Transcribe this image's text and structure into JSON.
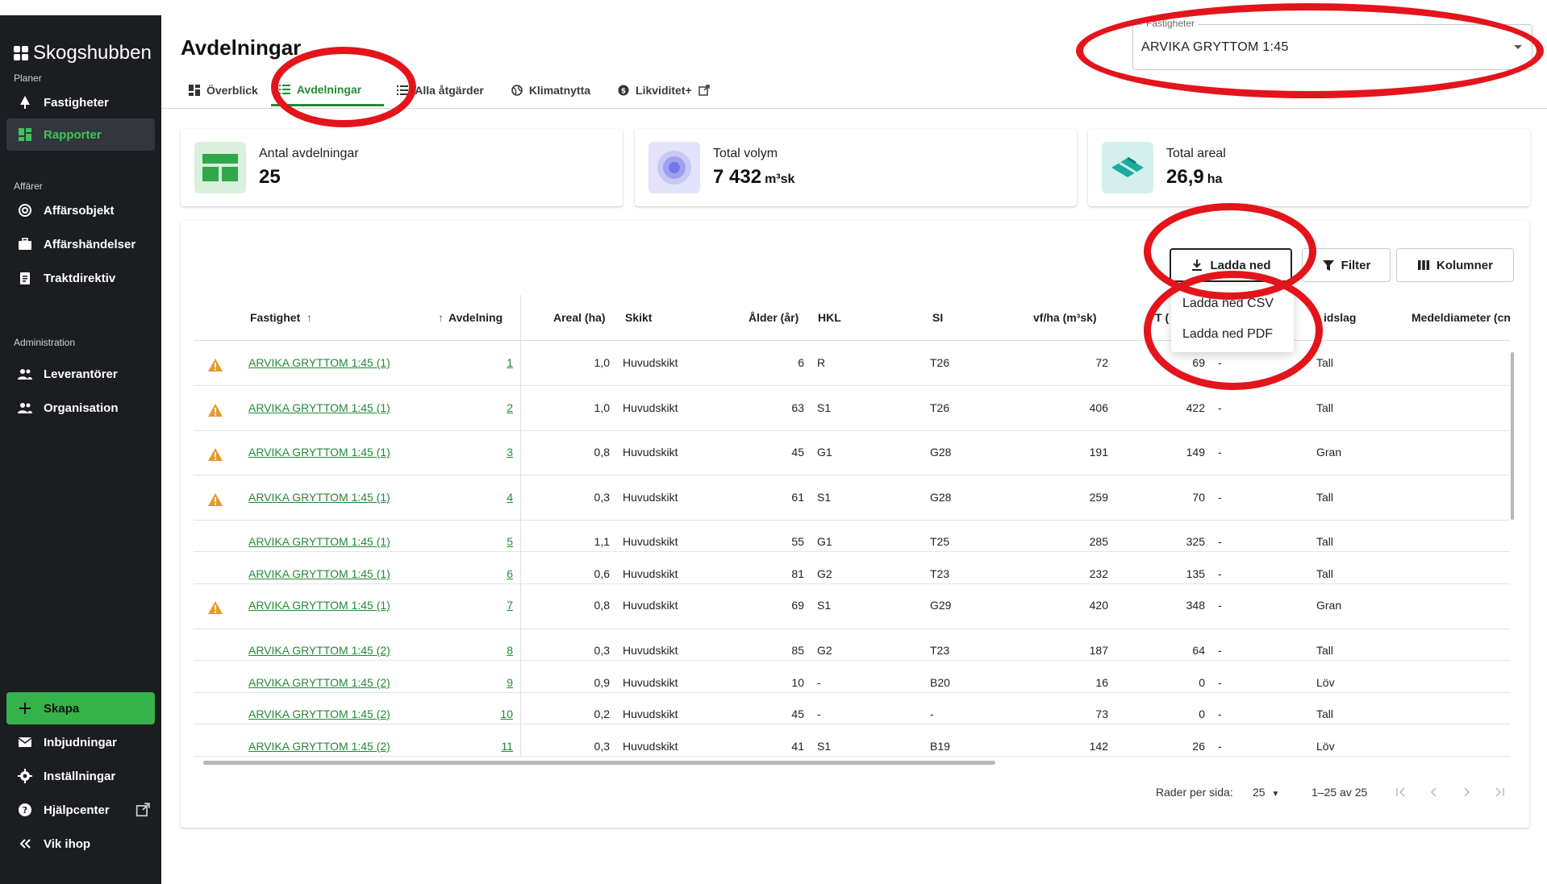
{
  "app": {
    "name": "Skogshubben"
  },
  "sidebar": {
    "sections": [
      "Planer",
      "Affärer",
      "Administration"
    ],
    "items": [
      {
        "label": "Fastigheter",
        "icon": "tree-icon"
      },
      {
        "label": "Rapporter",
        "icon": "grid-icon",
        "active": true
      },
      {
        "label": "Affärsobjekt",
        "icon": "target-icon"
      },
      {
        "label": "Affärshändelser",
        "icon": "briefcase-icon"
      },
      {
        "label": "Traktdirektiv",
        "icon": "clipboard-icon"
      },
      {
        "label": "Leverantörer",
        "icon": "people-icon"
      },
      {
        "label": "Organisation",
        "icon": "group-icon"
      }
    ],
    "bottom": [
      {
        "label": "Skapa",
        "icon": "plus-icon"
      },
      {
        "label": "Inbjudningar",
        "icon": "mail-icon"
      },
      {
        "label": "Inställningar",
        "icon": "gear-icon"
      },
      {
        "label": "Hjälpcenter",
        "icon": "help-icon"
      },
      {
        "label": "Vik ihop",
        "icon": "collapse-icon"
      }
    ]
  },
  "header": {
    "title": "Avdelningar",
    "tabs": [
      {
        "label": "Överblick",
        "icon": "dashboard-icon"
      },
      {
        "label": "Avdelningar",
        "icon": "list-icon",
        "active": true
      },
      {
        "label": "Alla åtgärder",
        "icon": "list-icon"
      },
      {
        "label": "Klimatnytta",
        "icon": "globe-icon"
      },
      {
        "label": "Likviditet+",
        "icon": "coin-icon"
      }
    ],
    "property_select": {
      "label": "Fastigheter",
      "value": "ARVIKA GRYTTOM 1:45"
    }
  },
  "stats": [
    {
      "label": "Antal avdelningar",
      "value": "25",
      "unit": "",
      "color": "#d8f0dc"
    },
    {
      "label": "Total volym",
      "value": "7 432",
      "unit": "m³sk",
      "color": "#e3e3fb"
    },
    {
      "label": "Total areal",
      "value": "26,9",
      "unit": "ha",
      "color": "#d3f0ee"
    }
  ],
  "toolbar": {
    "download_label": "Ladda ned",
    "filter_label": "Filter",
    "columns_label": "Kolumner",
    "menu": [
      "Ladda ned CSV",
      "Ladda ned PDF"
    ]
  },
  "table": {
    "headers": {
      "fastighet": "Fastighet",
      "avdelning": "Avdelning",
      "areal": "Areal (ha)",
      "skikt": "Skikt",
      "alder": "Ålder (år)",
      "hkl": "HKL",
      "si": "SI",
      "vfha": "vf/ha (m³sk)",
      "vol": "T (",
      "tradslag": "idslag",
      "medeldiameter": "Medeldiameter (cn"
    },
    "rows": [
      {
        "warn": true,
        "fastighet": "ARVIKA GRYTTOM 1:45 (1)",
        "avd": "1",
        "areal": "1,0",
        "skikt": "Huvudskikt",
        "alder": "6",
        "hkl": "R",
        "si": "T26",
        "vfha": "72",
        "vol": "69",
        "dash": "-",
        "tradslag": "Tall"
      },
      {
        "warn": true,
        "fastighet": "ARVIKA GRYTTOM 1:45 (1)",
        "avd": "2",
        "areal": "1,0",
        "skikt": "Huvudskikt",
        "alder": "63",
        "hkl": "S1",
        "si": "T26",
        "vfha": "406",
        "vol": "422",
        "dash": "-",
        "tradslag": "Tall"
      },
      {
        "warn": true,
        "fastighet": "ARVIKA GRYTTOM 1:45 (1)",
        "avd": "3",
        "areal": "0,8",
        "skikt": "Huvudskikt",
        "alder": "45",
        "hkl": "G1",
        "si": "G28",
        "vfha": "191",
        "vol": "149",
        "dash": "-",
        "tradslag": "Gran"
      },
      {
        "warn": true,
        "fastighet": "ARVIKA GRYTTOM 1:45 (1)",
        "avd": "4",
        "areal": "0,3",
        "skikt": "Huvudskikt",
        "alder": "61",
        "hkl": "S1",
        "si": "G28",
        "vfha": "259",
        "vol": "70",
        "dash": "-",
        "tradslag": "Tall"
      },
      {
        "warn": false,
        "fastighet": "ARVIKA GRYTTOM 1:45 (1)",
        "avd": "5",
        "areal": "1,1",
        "skikt": "Huvudskikt",
        "alder": "55",
        "hkl": "G1",
        "si": "T25",
        "vfha": "285",
        "vol": "325",
        "dash": "-",
        "tradslag": "Tall"
      },
      {
        "warn": false,
        "fastighet": "ARVIKA GRYTTOM 1:45 (1)",
        "avd": "6",
        "areal": "0,6",
        "skikt": "Huvudskikt",
        "alder": "81",
        "hkl": "G2",
        "si": "T23",
        "vfha": "232",
        "vol": "135",
        "dash": "-",
        "tradslag": "Tall"
      },
      {
        "warn": true,
        "fastighet": "ARVIKA GRYTTOM 1:45 (1)",
        "avd": "7",
        "areal": "0,8",
        "skikt": "Huvudskikt",
        "alder": "69",
        "hkl": "S1",
        "si": "G29",
        "vfha": "420",
        "vol": "348",
        "dash": "-",
        "tradslag": "Gran"
      },
      {
        "warn": false,
        "fastighet": "ARVIKA GRYTTOM 1:45 (2)",
        "avd": "8",
        "areal": "0,3",
        "skikt": "Huvudskikt",
        "alder": "85",
        "hkl": "G2",
        "si": "T23",
        "vfha": "187",
        "vol": "64",
        "dash": "-",
        "tradslag": "Tall"
      },
      {
        "warn": false,
        "fastighet": "ARVIKA GRYTTOM 1:45 (2)",
        "avd": "9",
        "areal": "0,9",
        "skikt": "Huvudskikt",
        "alder": "10",
        "hkl": "-",
        "si": "B20",
        "vfha": "16",
        "vol": "0",
        "dash": "-",
        "tradslag": "Löv"
      },
      {
        "warn": false,
        "fastighet": "ARVIKA GRYTTOM 1:45 (2)",
        "avd": "10",
        "areal": "0,2",
        "skikt": "Huvudskikt",
        "alder": "45",
        "hkl": "-",
        "si": "-",
        "vfha": "73",
        "vol": "0",
        "dash": "-",
        "tradslag": "Tall"
      },
      {
        "warn": false,
        "fastighet": "ARVIKA GRYTTOM 1:45 (2)",
        "avd": "11",
        "areal": "0,3",
        "skikt": "Huvudskikt",
        "alder": "41",
        "hkl": "S1",
        "si": "B19",
        "vfha": "142",
        "vol": "26",
        "dash": "-",
        "tradslag": "Löv"
      }
    ]
  },
  "pagination": {
    "rows_per_page_label": "Rader per sida:",
    "rows_per_page": "25",
    "range": "1–25 av 25"
  }
}
